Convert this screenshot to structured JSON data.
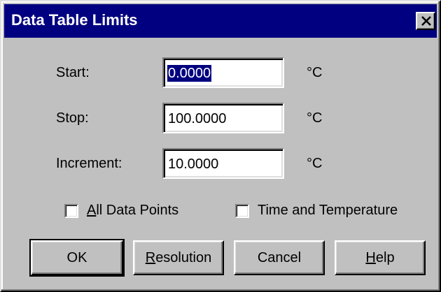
{
  "window": {
    "title": "Data Table Limits",
    "close_icon": "close-icon"
  },
  "fields": [
    {
      "label": "Start:",
      "value": "0.0000",
      "unit": "°C",
      "selected": true
    },
    {
      "label": "Stop:",
      "value": "100.0000",
      "unit": "°C",
      "selected": false
    },
    {
      "label": "Increment:",
      "value": "10.0000",
      "unit": "°C",
      "selected": false
    }
  ],
  "checkboxes": [
    {
      "label": "All Data Points",
      "mnemonic": "A",
      "checked": false
    },
    {
      "label": "Time and Temperature",
      "checked": false
    }
  ],
  "buttons": {
    "ok": "OK",
    "resolution": "Resolution",
    "resolution_mnemonic": "R",
    "cancel": "Cancel",
    "help": "Help",
    "help_mnemonic": "H"
  },
  "colors": {
    "face": "#c0c0c0",
    "titlebar": "#000080",
    "selection": "#000080"
  }
}
